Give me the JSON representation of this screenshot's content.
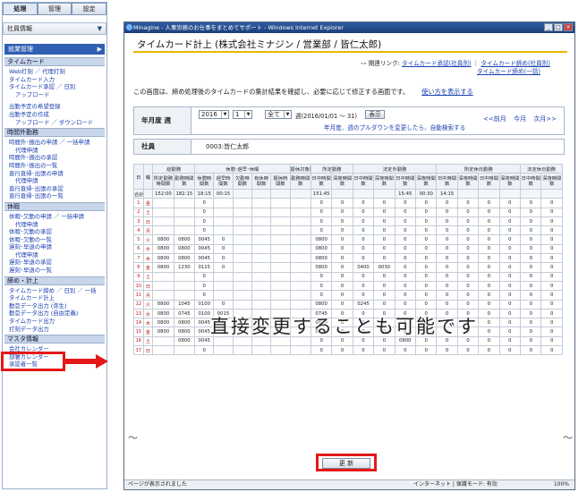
{
  "sidebar": {
    "tabs": [
      "処理",
      "管理",
      "設定"
    ],
    "shain_label": "社員情報",
    "menu_title": "就業管理",
    "sections": [
      {
        "title": "タイムカード",
        "items": [
          [
            "Web打刻 ／ 代理打刻",
            0
          ],
          [
            "タイムカード入力",
            0
          ],
          [
            "タイムカード承認 ／ 日別",
            0
          ],
          [
            "アップロード",
            1
          ],
          [
            "",
            0
          ],
          [
            "出勤予定の希望登録",
            0
          ],
          [
            "出勤予定の作成",
            0
          ],
          [
            "アップロード ／ ダウンロード",
            1
          ]
        ]
      },
      {
        "title": "時間外勤務",
        "items": [
          [
            "時間外･振出の申請 ／ 一括申請",
            0
          ],
          [
            "代理申請",
            1
          ],
          [
            "時間外･振出の承認",
            0
          ],
          [
            "時間外･振出の一覧",
            0
          ],
          [
            "直行直帰･出張の申請",
            0
          ],
          [
            "代理申請",
            1
          ],
          [
            "直行直帰･出張の承認",
            0
          ],
          [
            "直行直帰･出張の一覧",
            0
          ]
        ]
      },
      {
        "title": "休暇",
        "items": [
          [
            "休暇･欠勤の申請 ／ 一括申請",
            0
          ],
          [
            "代理申請",
            1
          ],
          [
            "休暇･欠勤の承認",
            0
          ],
          [
            "休暇･欠勤の一覧",
            0
          ],
          [
            "遅刻･早退の申請",
            0
          ],
          [
            "代理申請",
            1
          ],
          [
            "遅刻･早退の承認",
            0
          ],
          [
            "遅刻･早退の一覧",
            0
          ]
        ]
      },
      {
        "title": "締め・計上",
        "items": [
          [
            "タイムカード締め ／ 日別 ／ 一括",
            0
          ],
          [
            "タイムカード計上",
            0
          ],
          [
            "勤怠データ出力 (弥生)",
            0
          ],
          [
            "勤怠データ出力 (自由定義)",
            0
          ],
          [
            "タイムカード出力",
            0
          ],
          [
            "打刻データ出力",
            0
          ]
        ]
      },
      {
        "title": "マスタ情報",
        "items": [
          [
            "会社カレンダー",
            0
          ],
          [
            "部署カレンダー",
            0
          ],
          [
            "承認者一覧",
            0
          ]
        ]
      }
    ]
  },
  "browser": {
    "title_bar": "Minagine - 人事労務のお仕事をまとめてサポート - Windows Internet Explorer",
    "page_title": "タイムカード計上 (株式会社ミナジン / 営業部 / 皆仁太郎)",
    "related_label": "関連リンク:",
    "related_links": [
      "タイムカード承認(社員別)",
      "タイムカード締め(社員別)",
      "タイムカード締め(一括)"
    ],
    "description": "この画面は、締め処理後のタイムカードの集計結果を確認し、必要に応じて修正する画面です。",
    "howto": "使い方を表示する",
    "period_label": "年月度 週",
    "year": "2016",
    "month": "1",
    "week": "全て",
    "week_suffix": "週(2016/01/01 ～ 31)",
    "show_btn": "表示",
    "nav": [
      "<<前月",
      "今月",
      "次月>>"
    ],
    "hint": "年月度、週のプルダウンを変更したら、自動検索する",
    "employee_label": "社員",
    "employee_value": "0003:皆仁太郎",
    "overlay": "直接変更することも可能です",
    "update_btn": "更 新",
    "status_left": "ページが表示されました",
    "status_right": "インターネット | 保護モード: 有効",
    "zoom": "100%"
  },
  "grid": {
    "h1": [
      "日",
      "曜",
      "総勤務",
      "休憩･遅早･休暇",
      "振休対象勤務",
      "所定勤務",
      "法定外勤務",
      "所定休日勤務",
      "法定休日勤務"
    ],
    "h_sub": [
      "所定勤務時間数",
      "勤務時間数",
      "休憩時間数",
      "遅早時間数",
      "欠勤時間数",
      "有休時間数",
      "振休時間数",
      "勤務時間数",
      "日中時間数",
      "深夜時間数",
      "日中時間数",
      "深夜時間数",
      "日中時間数",
      "深夜時間数",
      "日中時間数",
      "深夜時間数",
      "日中時間数",
      "深夜時間数",
      "日中時間数",
      "深夜時間数"
    ],
    "total": [
      "合計",
      "",
      "152:00",
      "182:15",
      "18:15",
      "00:15",
      "",
      "",
      "",
      "",
      "151:45",
      "",
      "",
      "",
      "15:45",
      "00:30",
      "14:15",
      "",
      "",
      "",
      "",
      ""
    ],
    "rows": [
      [
        "1",
        "金",
        "",
        "",
        "0",
        "",
        "",
        "",
        "",
        "",
        "0",
        "0",
        "0",
        "0",
        "0",
        "0",
        "0",
        "0",
        "0",
        "0",
        "0",
        "0"
      ],
      [
        "2",
        "土",
        "",
        "",
        "0",
        "",
        "",
        "",
        "",
        "",
        "0",
        "0",
        "0",
        "0",
        "0",
        "0",
        "0",
        "0",
        "0",
        "0",
        "0",
        "0"
      ],
      [
        "3",
        "日",
        "",
        "",
        "0",
        "",
        "",
        "",
        "",
        "",
        "0",
        "0",
        "0",
        "0",
        "0",
        "0",
        "0",
        "0",
        "0",
        "0",
        "0",
        "0"
      ],
      [
        "4",
        "月",
        "",
        "",
        "0",
        "",
        "",
        "",
        "",
        "",
        "0",
        "0",
        "0",
        "0",
        "0",
        "0",
        "0",
        "0",
        "0",
        "0",
        "0",
        "0"
      ],
      [
        "5",
        "火",
        "0800",
        "0800",
        "0045",
        "0",
        "",
        "",
        "",
        "",
        "0800",
        "0",
        "0",
        "0",
        "0",
        "0",
        "0",
        "0",
        "0",
        "0",
        "0",
        "0"
      ],
      [
        "6",
        "水",
        "0800",
        "0800",
        "0045",
        "0",
        "",
        "",
        "",
        "",
        "0800",
        "0",
        "0",
        "0",
        "0",
        "0",
        "0",
        "0",
        "0",
        "0",
        "0",
        "0"
      ],
      [
        "7",
        "木",
        "0800",
        "0800",
        "0045",
        "0",
        "",
        "",
        "",
        "",
        "0800",
        "0",
        "0",
        "0",
        "0",
        "0",
        "0",
        "0",
        "0",
        "0",
        "0",
        "0"
      ],
      [
        "8",
        "金",
        "0800",
        "1230",
        "0115",
        "0",
        "",
        "",
        "",
        "",
        "0800",
        "0",
        "0400",
        "0030",
        "0",
        "0",
        "0",
        "0",
        "0",
        "0",
        "0",
        "0"
      ],
      [
        "9",
        "土",
        "",
        "",
        "0",
        "",
        "",
        "",
        "",
        "",
        "0",
        "0",
        "0",
        "0",
        "0",
        "0",
        "0",
        "0",
        "0",
        "0",
        "0",
        "0"
      ],
      [
        "10",
        "日",
        "",
        "",
        "0",
        "",
        "",
        "",
        "",
        "",
        "0",
        "0",
        "0",
        "0",
        "0",
        "0",
        "0",
        "0",
        "0",
        "0",
        "0",
        "0"
      ],
      [
        "11",
        "月",
        "",
        "",
        "0",
        "",
        "",
        "",
        "",
        "",
        "0",
        "0",
        "0",
        "0",
        "0",
        "0",
        "0",
        "0",
        "0",
        "0",
        "0",
        "0"
      ],
      [
        "12",
        "火",
        "0800",
        "1045",
        "0100",
        "0",
        "",
        "",
        "",
        "",
        "0800",
        "0",
        "0245",
        "0",
        "0",
        "0",
        "0",
        "0",
        "0",
        "0",
        "0",
        "0"
      ],
      [
        "13",
        "水",
        "0800",
        "0745",
        "0100",
        "0015",
        "",
        "",
        "",
        "",
        "0745",
        "0",
        "0",
        "0",
        "0",
        "0",
        "0",
        "0",
        "0",
        "0",
        "0",
        "0"
      ],
      [
        "14",
        "木",
        "0800",
        "0800",
        "0045",
        "0",
        "",
        "",
        "",
        "",
        "0800",
        "0",
        "0",
        "0",
        "0",
        "0",
        "0",
        "0",
        "0",
        "0",
        "0",
        "0"
      ],
      [
        "15",
        "金",
        "0800",
        "0800",
        "0045",
        "0",
        "",
        "",
        "",
        "",
        "0800",
        "0",
        "0",
        "0",
        "0",
        "0",
        "0",
        "0",
        "0",
        "0",
        "0",
        "0"
      ],
      [
        "16",
        "土",
        "",
        "0800",
        "0045",
        "",
        "",
        "",
        "",
        "",
        "0",
        "0",
        "0",
        "0",
        "0800",
        "0",
        "0",
        "0",
        "0",
        "0",
        "0",
        "0"
      ],
      [
        "17",
        "日",
        "",
        "",
        "0",
        "",
        "",
        "",
        "",
        "",
        "0",
        "0",
        "0",
        "0",
        "0",
        "0",
        "0",
        "0",
        "0",
        "0",
        "0",
        "0"
      ]
    ]
  }
}
